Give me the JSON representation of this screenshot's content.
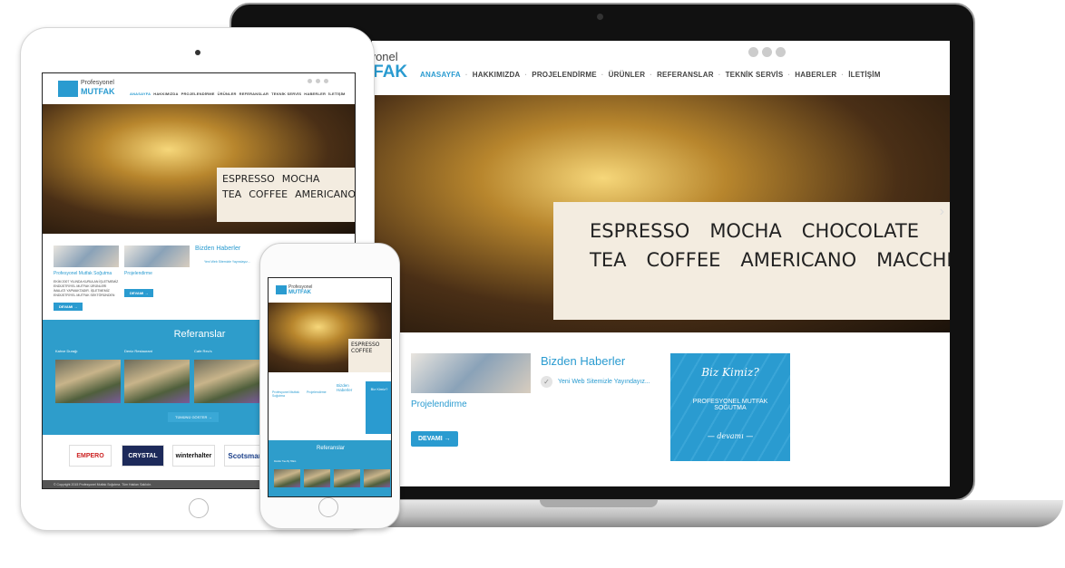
{
  "site": {
    "logo_line1": "Profesyonel",
    "logo_line2": "MUTFAK",
    "nav": [
      "ANASAYFA",
      "HAKKIMIZDA",
      "PROJELENDİRME",
      "ÜRÜNLER",
      "REFERANSLAR",
      "TEKNİK SERVİS",
      "HABERLER",
      "İLETİŞİM"
    ],
    "social_icons": [
      "facebook-icon",
      "google-plus-icon",
      "twitter-icon"
    ],
    "hero_board": {
      "row1": [
        "ESPRESSO",
        "MOCHA",
        "CHOCOLATE"
      ],
      "row2": [
        "TEA",
        "COFFEE",
        "AMERICANO",
        "MACCHI"
      ]
    },
    "card1_title": "Profesyonel Mutfak Soğutma",
    "card1_text": "EKİM 2007 YILINDA KURULAN İŞLETMEMİZ ENDÜSTRİYEL MUTFAK ÜRÜNLERİ İMALATI YAPMAKTADIR. İŞLETMEMİZ ENDÜSTRİYEL MUTFAK SEKTÖRÜNDEN",
    "card2_title": "Projelendirme",
    "more_button": "DEVAMI →",
    "news_title": "Bizden Haberler",
    "news_item": "Yeni Web Sitemizle Yayındayız...",
    "about_title": "Biz Kimiz?",
    "about_text": "PROFESYONEL MUTFAK SOĞUTMA",
    "about_more": "— devamı —",
    "refs_title": "Referanslar",
    "refs": [
      "Double Tree By Hilton",
      "Kahve Durağı",
      "Deniz Restaurant",
      "Cafe Reu's"
    ],
    "show_all": "TÜMÜNÜ GÖSTER →",
    "brands": [
      "EMPERO",
      "CRYSTAL",
      "winterhalter",
      "Scotsman"
    ],
    "footer": "© Copyright 2015 Profesyonel Mutfak Soğutma. Tüm Hakları Saklıdır."
  },
  "colors": {
    "accent": "#2a9bd0",
    "refs_bg": "#2e9dcb"
  }
}
